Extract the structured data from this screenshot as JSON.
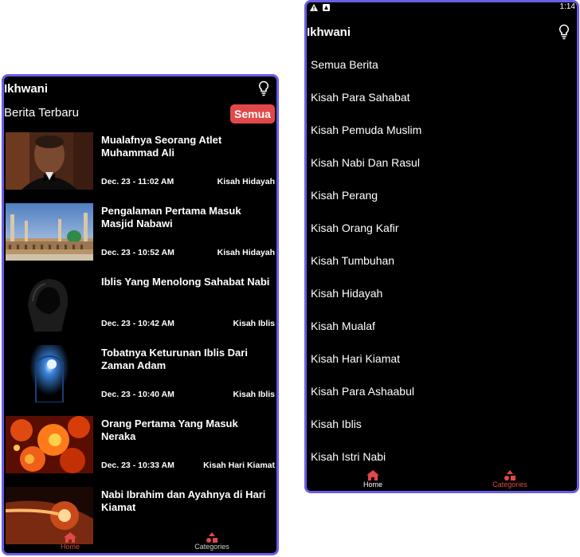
{
  "left_screen": {
    "app_title": "Ikhwani",
    "section_title": "Berita Terbaru",
    "semua_label": "Semua",
    "news": [
      {
        "title": "Mualafnya Seorang Atlet Muhammad Ali",
        "date": "Dec. 23 - 11:02 AM",
        "category": "Kisah Hidayah"
      },
      {
        "title": "Pengalaman Pertama Masuk Masjid Nabawi",
        "date": "Dec. 23 - 10:52 AM",
        "category": "Kisah Hidayah"
      },
      {
        "title": "Iblis Yang Menolong Sahabat Nabi",
        "date": "Dec. 23 - 10:42 AM",
        "category": "Kisah Iblis"
      },
      {
        "title": "Tobatnya Keturunan Iblis Dari Zaman Adam",
        "date": "Dec. 23 - 10:40 AM",
        "category": "Kisah Iblis"
      },
      {
        "title": "Orang Pertama Yang Masuk Neraka",
        "date": "Dec. 23 - 10:33 AM",
        "category": "Kisah Hari Kiamat"
      },
      {
        "title": "Nabi Ibrahim dan Ayahnya di Hari Kiamat",
        "date": "",
        "category": ""
      }
    ],
    "nav": {
      "home_label": "Home",
      "categories_label": "Categories"
    }
  },
  "right_screen": {
    "status_time": "1:14",
    "app_title": "Ikhwani",
    "categories": [
      "Semua Berita",
      "Kisah Para Sahabat",
      "Kisah Pemuda Muslim",
      "Kisah Nabi Dan Rasul",
      "Kisah Perang",
      "Kisah Orang Kafir",
      "Kisah Tumbuhan",
      "Kisah Hidayah",
      "Kisah Mualaf",
      "Kisah Hari Kiamat",
      "Kisah Para Ashaabul",
      "Kisah Iblis",
      "Kisah Istri Nabi"
    ],
    "nav": {
      "home_label": "Home",
      "categories_label": "Categories"
    }
  },
  "colors": {
    "accent": "#e24848",
    "frame": "#6a5ee8",
    "background": "#000000",
    "text": "#ffffff"
  }
}
